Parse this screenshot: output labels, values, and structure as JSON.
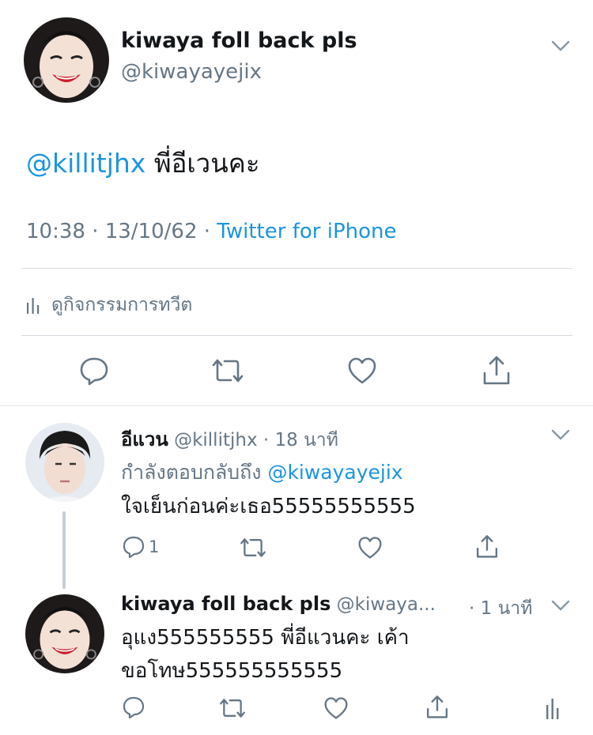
{
  "main_tweet": {
    "author_name": "kiwaya foll back pls",
    "author_handle": "@kiwayayejix",
    "mention": "@killitjhx",
    "text": " พี่อีเวนคะ",
    "time": "10:38 · 13/10/62 · ",
    "source": "Twitter for iPhone",
    "activity_label": "ดูกิจกรรมการทวีต"
  },
  "reply1": {
    "author_name": "อีแวน",
    "author_handle": "@killitjhx",
    "time": " · 18 นาที",
    "replying_prefix": "กำลังตอบกลับถึง ",
    "replying_handle": "@kiwayayejix",
    "text": "ใจเย็นก่อนค่ะเธอ55555555555",
    "reply_count": "1"
  },
  "reply2": {
    "author_name": "kiwaya foll back pls",
    "author_handle": "@kiwaya...",
    "time": "· 1 นาที",
    "text_line1": "อุแง555555555 พี่อีแวนคะ เค้า",
    "text_line2": "ขอโทษ555555555555"
  },
  "colors": {
    "accent": "#1b95e0",
    "secondary_text": "#657786",
    "icon": "#657786",
    "divider": "#d6dbe0"
  },
  "icons": [
    "chevron-down-icon",
    "reply-icon",
    "retweet-icon",
    "like-icon",
    "share-icon",
    "analytics-icon"
  ]
}
